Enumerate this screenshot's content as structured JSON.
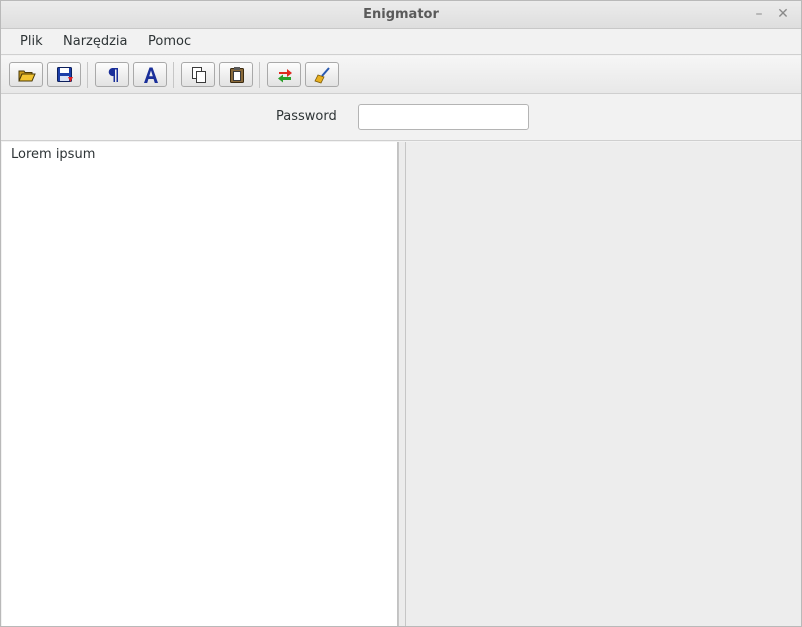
{
  "window": {
    "title": "Enigmator",
    "minimize_glyph": "–",
    "close_glyph": "✕"
  },
  "menubar": {
    "items": [
      {
        "label": "Plik"
      },
      {
        "label": "Narzędzia"
      },
      {
        "label": "Pomoc"
      }
    ]
  },
  "toolbar": {
    "buttons": [
      {
        "icon": "open-folder-icon"
      },
      {
        "icon": "save-icon"
      },
      {
        "icon": "paragraph-icon"
      },
      {
        "icon": "font-icon"
      },
      {
        "icon": "copy-icon"
      },
      {
        "icon": "paste-icon"
      },
      {
        "icon": "swap-icon"
      },
      {
        "icon": "clear-broom-icon"
      }
    ]
  },
  "password": {
    "label": "Password",
    "value": "",
    "placeholder": ""
  },
  "left_pane": {
    "text": "Lorem ipsum"
  },
  "right_pane": {
    "text": ""
  }
}
